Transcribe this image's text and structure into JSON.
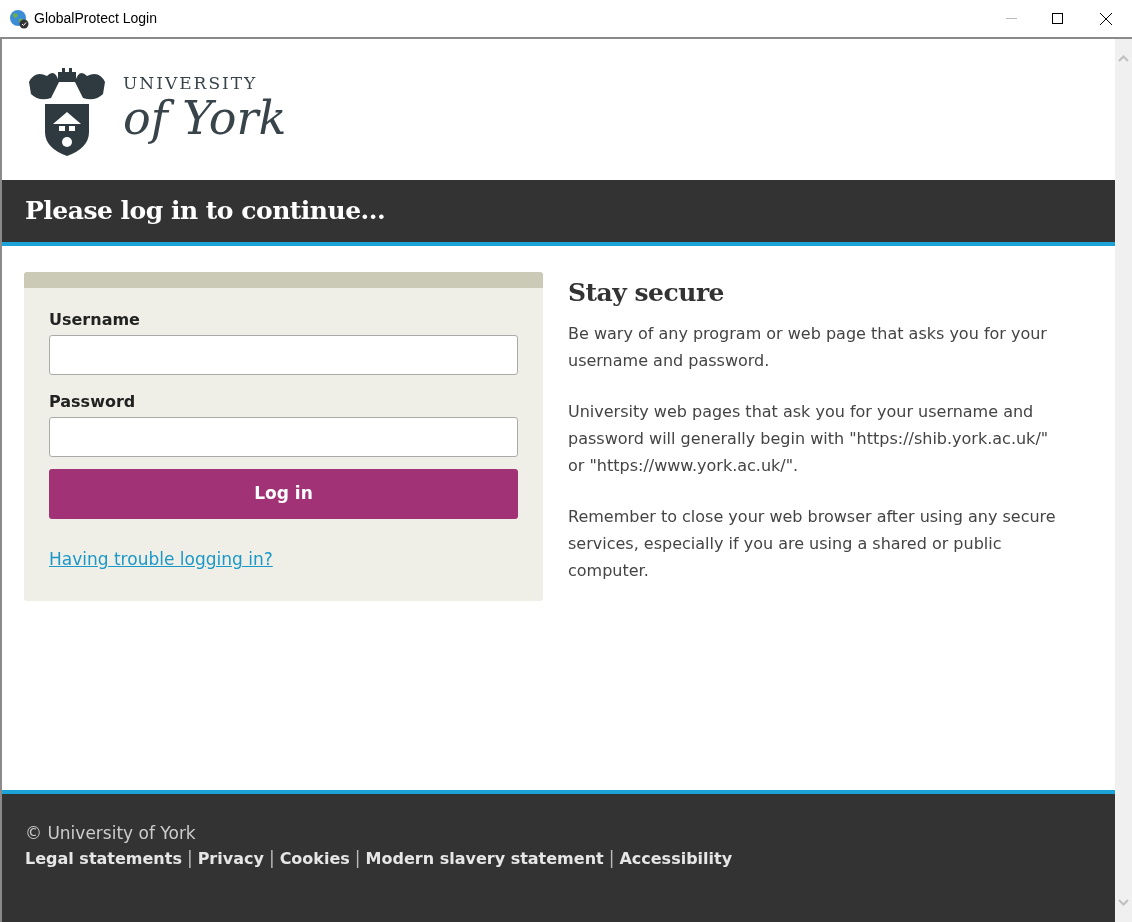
{
  "window": {
    "title": "GlobalProtect Login"
  },
  "logo": {
    "line_1": "UNIVERSITY",
    "line_2": "of York"
  },
  "banner": {
    "title": "Please log in to continue..."
  },
  "login_form": {
    "username_label": "Username",
    "password_label": "Password",
    "button": "Log in",
    "help_link": "Having trouble logging in?"
  },
  "info": {
    "title": "Stay secure",
    "paragraphs": [
      "Be wary of any program or web page that asks you for your username and password.",
      "University web pages that ask you for your username and password will generally begin with \"https://shib.york.ac.uk/\" or \"https://www.york.ac.uk/\".",
      "Remember to close your web browser after using any secure services, especially if you are using a shared or public computer."
    ]
  },
  "footer": {
    "copyright": "© University of York",
    "items": [
      {
        "kind": "link",
        "text": "Legal statements"
      },
      {
        "kind": "separator",
        "text": "|"
      },
      {
        "kind": "link",
        "text": "Privacy"
      },
      {
        "kind": "separator",
        "text": "|"
      },
      {
        "kind": "link",
        "text": "Cookies"
      },
      {
        "kind": "separator",
        "text": "|"
      },
      {
        "kind": "link",
        "text": "Modern slavery statement"
      },
      {
        "kind": "separator",
        "text": "|"
      },
      {
        "kind": "link",
        "text": "Accessibility"
      }
    ]
  }
}
